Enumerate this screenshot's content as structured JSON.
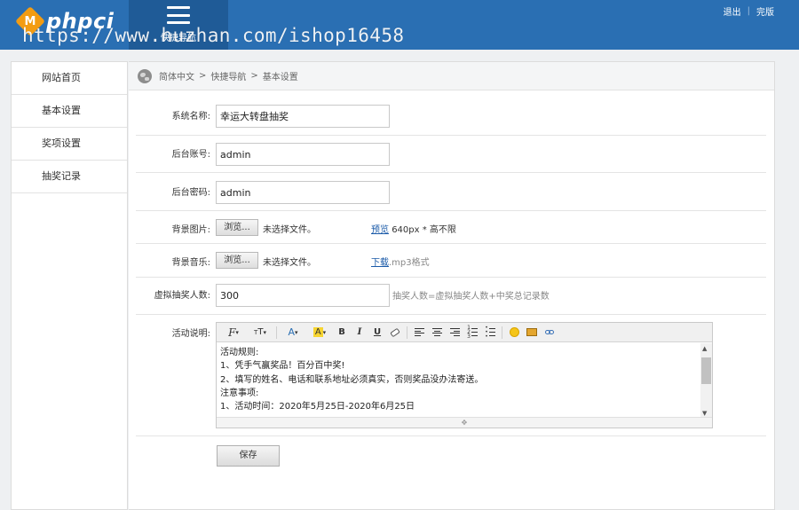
{
  "header": {
    "logo_badge": "M",
    "logo_text": "phpci",
    "quick_nav_label": "快捷导航",
    "watermark": "https://www.huzhan.com/ishop16458",
    "logout": "退出",
    "separator": "|",
    "done": "完版"
  },
  "sidebar": {
    "items": [
      {
        "label": "网站首页"
      },
      {
        "label": "基本设置"
      },
      {
        "label": "奖项设置"
      },
      {
        "label": "抽奖记录"
      }
    ]
  },
  "breadcrumb": {
    "items": [
      "简体中文",
      "快捷导航",
      "基本设置"
    ],
    "separator": ">"
  },
  "form": {
    "system_name": {
      "label": "系统名称:",
      "value": "幸运大转盘抽奖"
    },
    "admin_account": {
      "label": "后台账号:",
      "value": "admin"
    },
    "admin_password": {
      "label": "后台密码:",
      "value": "admin"
    },
    "background_image": {
      "label": "背景图片:",
      "browse": "浏览...",
      "file_status": "未选择文件。",
      "link": "预览",
      "hint": "640px * 高不限"
    },
    "background_music": {
      "label": "背景音乐:",
      "browse": "浏览...",
      "file_status": "未选择文件。",
      "link": "下载",
      "hint": ".mp3格式"
    },
    "virtual_count": {
      "label": "虚拟抽奖人数:",
      "value": "300",
      "hint": "抽奖人数=虚拟抽奖人数+中奖总记录数"
    },
    "description": {
      "label": "活动说明:",
      "toolbar": [
        "font-family",
        "font-size",
        "font-color",
        "highlight-color",
        "bold",
        "italic",
        "underline",
        "eraser",
        "align-left",
        "align-center",
        "align-right",
        "ordered-list",
        "unordered-list",
        "emoticon",
        "image",
        "link"
      ],
      "lines": [
        "活动规则:",
        "1、凭手气赢奖品！百分百中奖!",
        "2、填写的姓名、电话和联系地址必须真实，否则奖品没办法寄送。",
        "注意事项:",
        "1、活动时间：2020年5月25日-2020年6月25日"
      ]
    },
    "save_button": "保存"
  },
  "colors": {
    "header_bg": "#2a6fb3",
    "quick_nav_bg": "#1f5b97",
    "logo_badge": "#f39c12",
    "link": "#1a5aa8"
  }
}
